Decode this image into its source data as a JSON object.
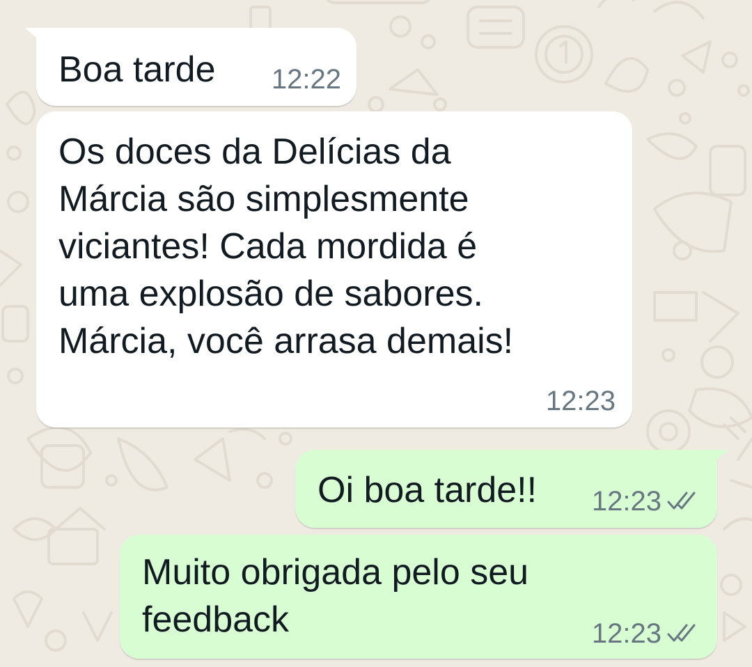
{
  "colors": {
    "background": "#efeae2",
    "incoming_bubble": "#ffffff",
    "outgoing_bubble": "#d9fdd3",
    "text": "#111b21",
    "timestamp": "#667781",
    "doodle": "#e2dbd1"
  },
  "icons": {
    "read_receipt": "double-check-icon"
  },
  "messages": [
    {
      "direction": "incoming",
      "text": "Boa tarde",
      "time": "12:22"
    },
    {
      "direction": "incoming",
      "text": "Os doces da Delícias da\nMárcia são simplesmente\nviciantes! Cada mordida é\numa explosão de sabores.\nMárcia, você arrasa demais!",
      "time": "12:23"
    },
    {
      "direction": "outgoing",
      "text": "Oi boa tarde!!",
      "time": "12:23",
      "status": "read"
    },
    {
      "direction": "outgoing",
      "text": "Muito obrigada pelo seu\nfeedback",
      "time": "12:23",
      "status": "read"
    }
  ]
}
